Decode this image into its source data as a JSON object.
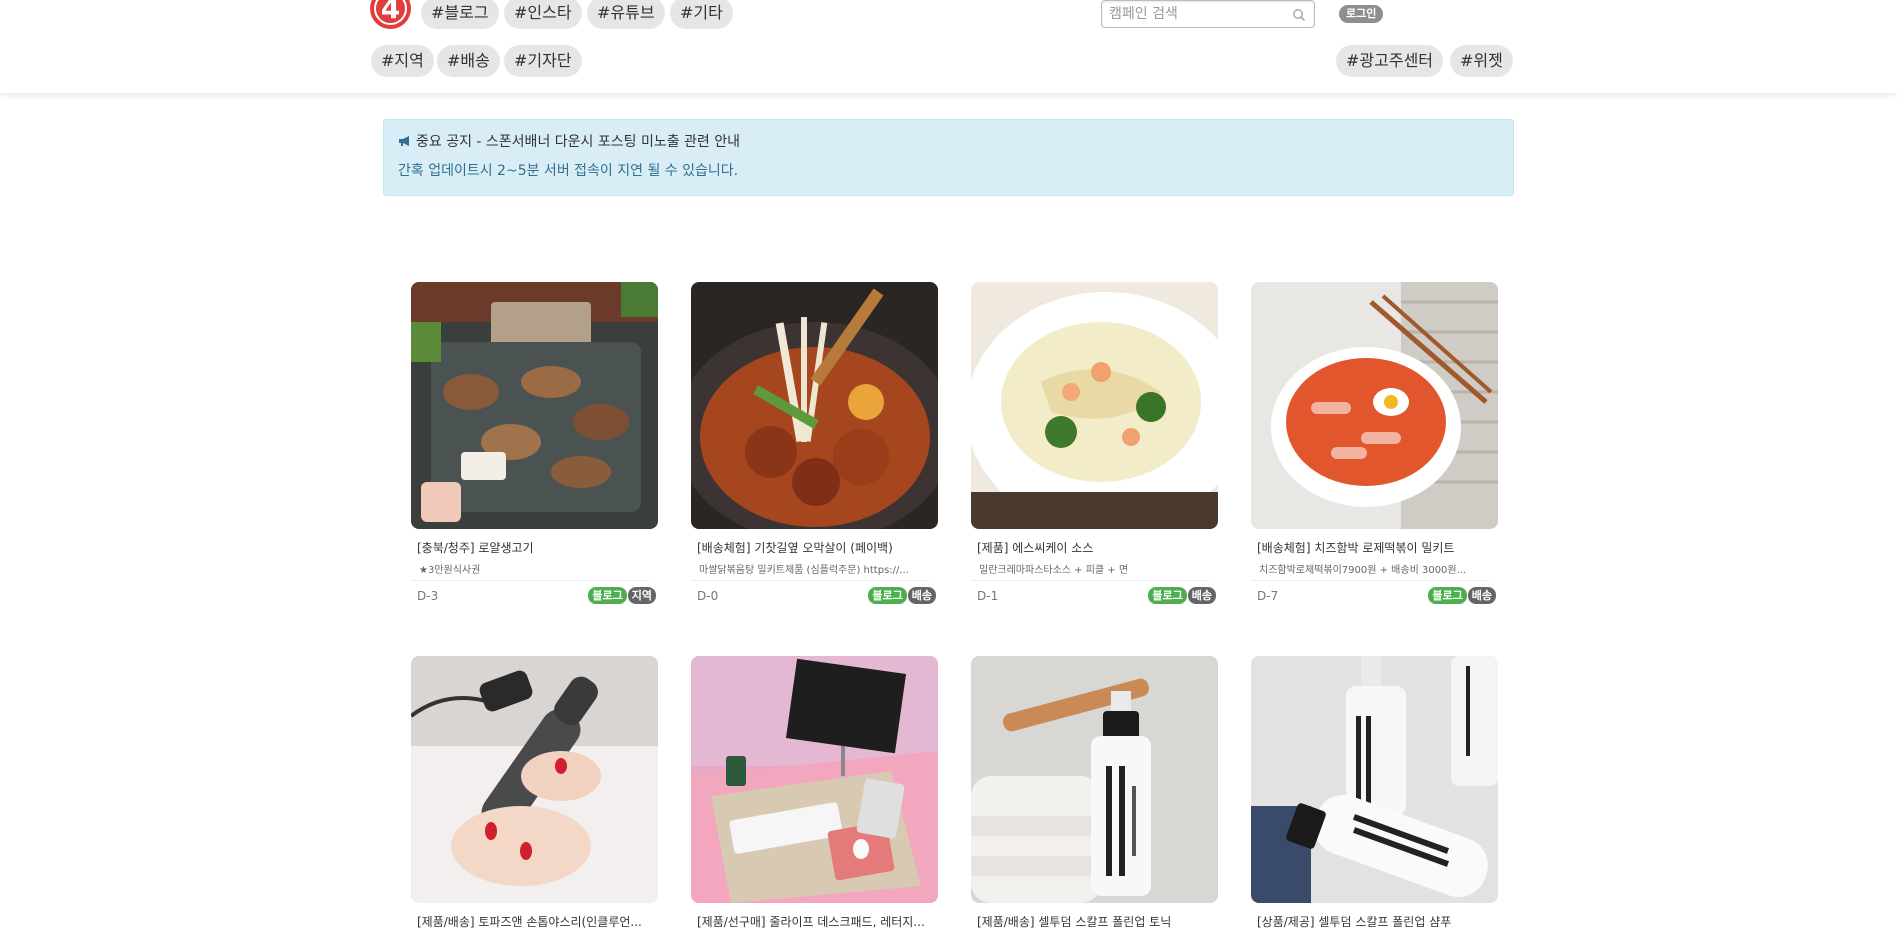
{
  "header": {
    "logo_text": "4",
    "top_tags": [
      "#블로그",
      "#인스타",
      "#유튜브",
      "#기타"
    ],
    "second_tags": [
      "#지역",
      "#배송",
      "#기자단"
    ],
    "right_tags": [
      "#광고주센터",
      "#위젯"
    ],
    "search_placeholder": "캠페인 검색",
    "login_label": "로그인"
  },
  "notice": {
    "title": "중요 공지 - 스폰서배너 다운시 포스팅 미노출 관련 안내",
    "subtitle": "간혹 업데이트시 2~5분 서버 접속이 지연 될 수 있습니다."
  },
  "colors": {
    "accent_red": "#e23c3c",
    "blog_badge": "#4cae4c",
    "type_badge": "#666666",
    "notice_bg": "#d9edf7"
  },
  "cards": [
    {
      "title": "[충북/청주] 로얄생고기",
      "desc": "★3만원식사권",
      "dday": "D-3",
      "badges": [
        "블로그",
        "지역"
      ],
      "image": "grilled-pork-image"
    },
    {
      "title": "[배송체험] 기찻길옆 오막살이 (페이백)",
      "desc": "마쌀닭볶음탕 밀키트제품 (심플럭주문) https://...",
      "dday": "D-0",
      "badges": [
        "블로그",
        "배송"
      ],
      "image": "braised-chicken-image"
    },
    {
      "title": "[제품] 에스씨케이 소스",
      "desc": "밀란크레마파스타소스 + 피클 + 면",
      "dday": "D-1",
      "badges": [
        "블로그",
        "배송"
      ],
      "image": "cream-pasta-image"
    },
    {
      "title": "[배송체험] 치즈함박 로제떡볶이 밀키트",
      "desc": "치즈함박로제떡볶이7900원 + 배송비 3000원...",
      "dday": "D-7",
      "badges": [
        "블로그",
        "배송"
      ],
      "image": "tteokbokki-image"
    },
    {
      "title": "[제품/배송] 토파즈앤 손톱야스리(인클루언...",
      "desc": "",
      "dday": "",
      "badges": [],
      "image": "nail-drill-image"
    },
    {
      "title": "[제품/선구매] 줄라이프 데스크패드, 레터지...",
      "desc": "",
      "dday": "",
      "badges": [],
      "image": "desk-pad-image"
    },
    {
      "title": "[제품/배송] 셀투덤 스칼프 폴린업 토닉",
      "desc": "",
      "dday": "",
      "badges": [],
      "image": "scalp-tonic-image"
    },
    {
      "title": "[상품/제공] 셀투덤 스칼프 폴린업 샴푸",
      "desc": "",
      "dday": "",
      "badges": [],
      "image": "scalp-shampoo-image"
    }
  ]
}
